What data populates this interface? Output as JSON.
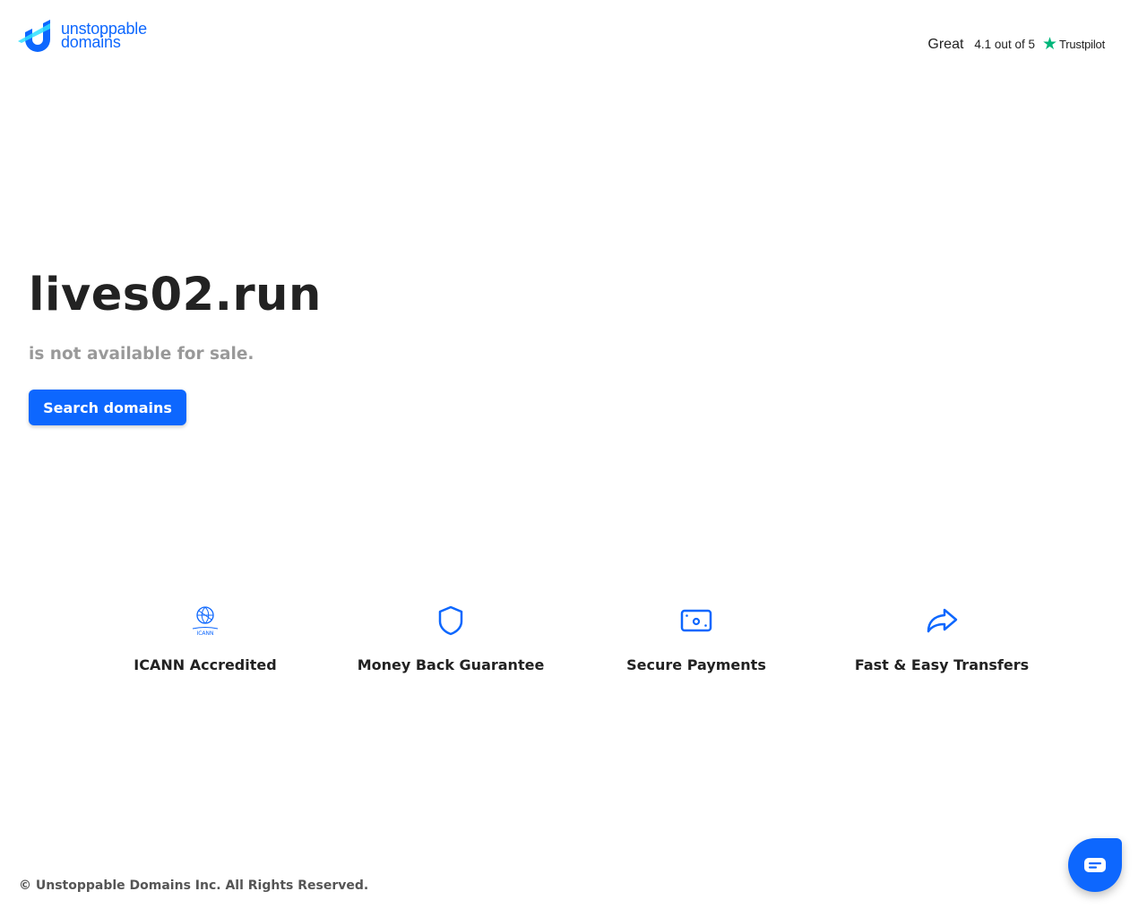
{
  "header": {
    "logo_text_line1": "unstoppable",
    "logo_text_line2": "domains",
    "rating_label": "Great",
    "rating_score": "4.1 out of 5",
    "rating_brand": "Trustpilot"
  },
  "main": {
    "domain": "lives02.run",
    "status": "is not available for sale.",
    "search_button": "Search domains"
  },
  "features": [
    {
      "label": "ICANN Accredited",
      "icon": "icann-icon",
      "icon_text": "ICANN"
    },
    {
      "label": "Money Back Guarantee",
      "icon": "shield-icon"
    },
    {
      "label": "Secure Payments",
      "icon": "payment-icon"
    },
    {
      "label": "Fast & Easy Transfers",
      "icon": "share-arrow-icon"
    }
  ],
  "footer": {
    "copyright": "© Unstoppable Domains Inc. All Rights Reserved."
  },
  "colors": {
    "brand": "#0d67fe",
    "trustpilot": "#00b67a"
  }
}
